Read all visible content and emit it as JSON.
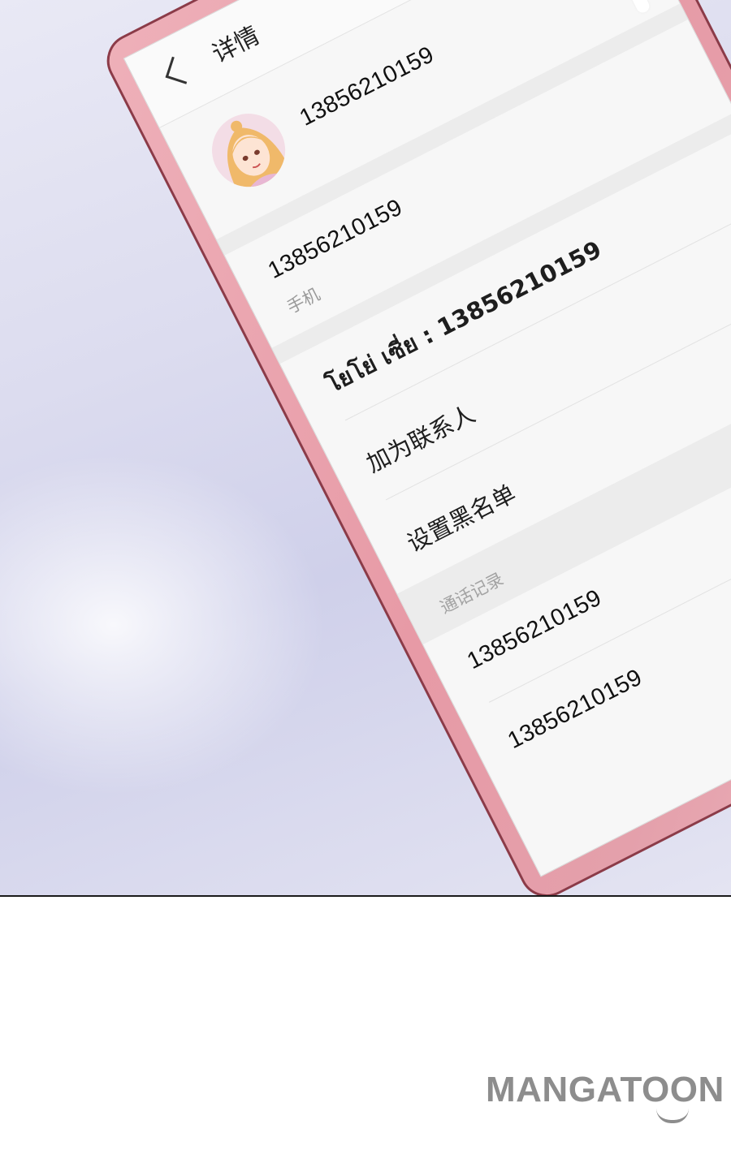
{
  "app": {
    "title": "详情",
    "contact_number_header": "13856210159"
  },
  "contact": {
    "number": "13856210159",
    "number_type": "手机",
    "thai_label_line": "โยโย่ เซี่ย : 13856210159"
  },
  "actions": [
    {
      "label": "加为联系人"
    },
    {
      "label": "设置黑名单"
    }
  ],
  "call_log": {
    "section_title": "通话记录",
    "entries": [
      "13856210159",
      "13856210159"
    ]
  },
  "icons": {
    "back": "back-arrow-icon",
    "message": "message-bubble-icon",
    "avatar": "avatar-portrait-icon"
  },
  "colors": {
    "phone_body": "#e79aa6",
    "phone_border": "#8c3b48",
    "screen_bg": "#f7f7f7",
    "logo": "#8d8d8d"
  },
  "branding": {
    "logo_text": "MANGATOON"
  }
}
